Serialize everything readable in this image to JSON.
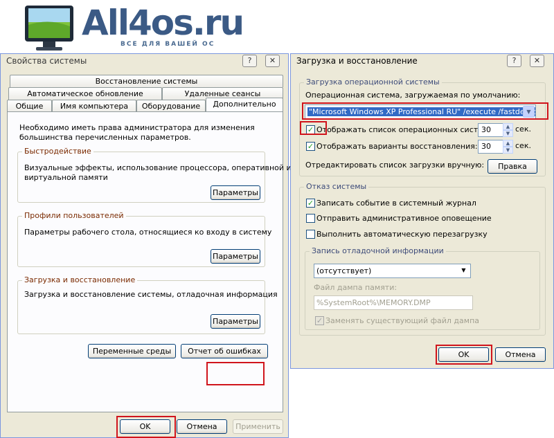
{
  "logo": {
    "brand": "All4os.ru",
    "tagline": "ВСЕ ДЛЯ ВАШЕЙ ОС"
  },
  "sys": {
    "title": "Свойства системы",
    "help_glyph": "?",
    "close_glyph": "✕",
    "tabs_row1": [
      "Восстановление системы"
    ],
    "tabs_row2": [
      "Автоматическое обновление",
      "Удаленные сеансы"
    ],
    "tabs_row3": [
      "Общие",
      "Имя компьютера",
      "Оборудование",
      "Дополнительно"
    ],
    "admin_note_1": "Необходимо иметь права администратора для изменения",
    "admin_note_2": "большинства перечисленных параметров.",
    "perf": {
      "title": "Быстродействие",
      "desc_1": "Визуальные эффекты, использование процессора, оперативной и",
      "desc_2": "виртуальной памяти",
      "button": "Параметры"
    },
    "profiles": {
      "title": "Профили пользователей",
      "desc": "Параметры рабочего стола, относящиеся ко входу в систему",
      "button": "Параметры"
    },
    "startup": {
      "title": "Загрузка и восстановление",
      "desc": "Загрузка и восстановление системы, отладочная информация",
      "button": "Параметры"
    },
    "env_button": "Переменные среды",
    "error_button": "Отчет об ошибках",
    "ok": "OK",
    "cancel": "Отмена",
    "apply": "Применить"
  },
  "boot": {
    "title": "Загрузка и восстановление",
    "help_glyph": "?",
    "close_glyph": "✕",
    "os_group": "Загрузка операционной системы",
    "default_os_label": "Операционная система, загружаемая по умолчанию:",
    "default_os_value": "\"Microsoft Windows XP Professional RU\" /execute /fastdetect",
    "show_list_label": "Отображать список операционных систем:",
    "show_list_checked": "✓",
    "show_list_value": "30",
    "show_recovery_label": "Отображать варианты восстановления:",
    "show_recovery_checked": "✓",
    "show_recovery_value": "30",
    "sec": "сек.",
    "edit_label": "Отредактировать список загрузки вручную:",
    "edit_button": "Правка",
    "failure_group": "Отказ системы",
    "log_event_label": "Записать событие в системный журнал",
    "log_event_checked": "✓",
    "admin_alert_label": "Отправить административное оповещение",
    "auto_restart_label": "Выполнить автоматическую перезагрузку",
    "debug_group": "Запись отладочной информации",
    "debug_select": "(отсутствует)",
    "dump_file_label": "Файл дампа памяти:",
    "dump_file_value": "%SystemRoot%\\MEMORY.DMP",
    "overwrite_label": "Заменять существующий файл дампа",
    "overwrite_checked": "✓",
    "ok": "OK",
    "cancel": "Отмена"
  },
  "colors": {
    "highlight": "#d0141c",
    "window_bg": "#ece9d8",
    "accent_text": "#7a2a00"
  }
}
